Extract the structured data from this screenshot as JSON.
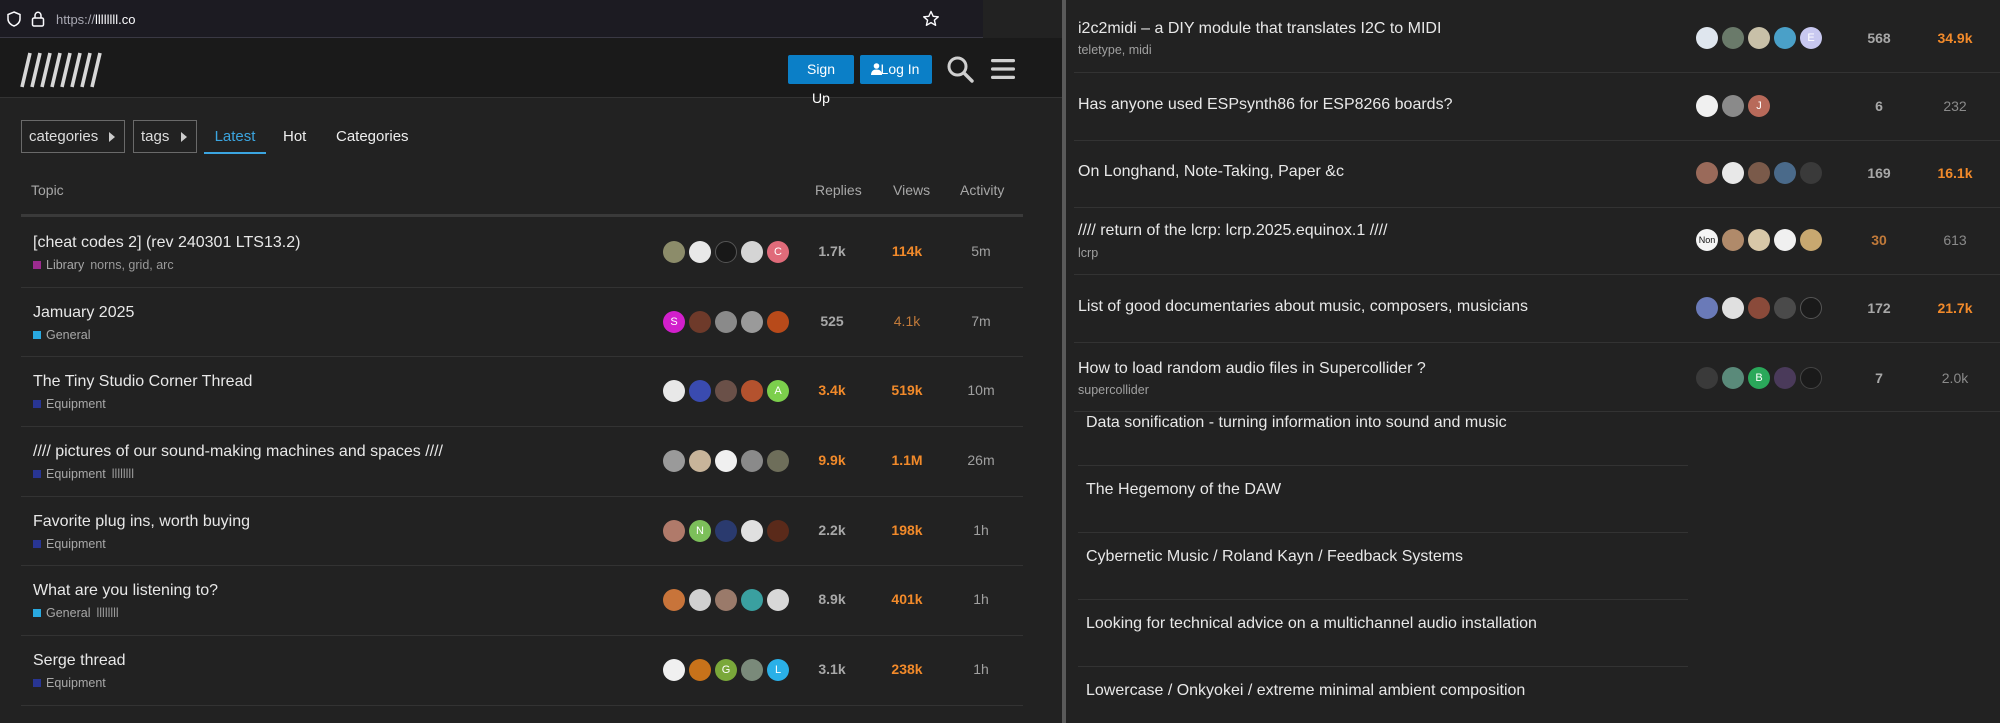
{
  "browser": {
    "url_scheme": "https://",
    "url_host": "llllllll.co"
  },
  "header": {
    "signup_label": "Sign Up",
    "login_label": "Log In"
  },
  "nav": {
    "categories_label": "categories",
    "tags_label": "tags",
    "latest_label": "Latest",
    "hot_label": "Hot",
    "categories_link_label": "Categories"
  },
  "table": {
    "col_topic": "Topic",
    "col_replies": "Replies",
    "col_views": "Views",
    "col_activity": "Activity"
  },
  "colors": {
    "library": "#9c2b8f",
    "general": "#29a9e0",
    "equipment": "#283593",
    "hot": "#f28a2a",
    "accent": "#0b7fc7"
  },
  "left_topics": [
    {
      "title": "[cheat codes 2] (rev 240301 LTS13.2)",
      "category": "Library",
      "tags": "norns, grid, arc",
      "replies": "1.7k",
      "views": "114k",
      "activity": "5m"
    },
    {
      "title": "Jamuary 2025",
      "category": "General",
      "tags": "",
      "replies": "525",
      "views": "4.1k",
      "activity": "7m"
    },
    {
      "title": "The Tiny Studio Corner Thread",
      "category": "Equipment",
      "tags": "",
      "replies": "3.4k",
      "views": "519k",
      "activity": "10m"
    },
    {
      "title": "//// pictures of our sound-making machines and spaces ////",
      "category": "Equipment",
      "tags": "llllllll",
      "replies": "9.9k",
      "views": "1.1M",
      "activity": "26m"
    },
    {
      "title": "Favorite plug ins, worth buying",
      "category": "Equipment",
      "tags": "",
      "replies": "2.2k",
      "views": "198k",
      "activity": "1h"
    },
    {
      "title": "What are you listening to?",
      "category": "General",
      "tags": "llllllll",
      "replies": "8.9k",
      "views": "401k",
      "activity": "1h"
    },
    {
      "title": "Serge thread",
      "category": "Equipment",
      "tags": "",
      "replies": "3.1k",
      "views": "238k",
      "activity": "1h"
    }
  ],
  "avatar_letters": {
    "row0": "C",
    "row1_first": "S",
    "row2_last": "A",
    "row4_second": "N",
    "row6_third": "G",
    "row6_last": "L",
    "r0_last": "E",
    "r1_last": "J",
    "r3_first": "Non",
    "r5_third": "B"
  },
  "right_topics": [
    {
      "title": "i2c2midi – a DIY module that translates I2C to MIDI",
      "tags": "teletype, midi",
      "replies": "568",
      "views": "34.9k"
    },
    {
      "title": "Has anyone used ESPsynth86 for ESP8266 boards?",
      "tags": "",
      "replies": "6",
      "views": "232"
    },
    {
      "title": "On Longhand, Note-Taking, Paper &c",
      "tags": "",
      "replies": "169",
      "views": "16.1k"
    },
    {
      "title": "//// return of the lcrp: lcrp.2025.equinox.1 ////",
      "tags": "lcrp",
      "replies": "30",
      "views": "613"
    },
    {
      "title": "List of good documentaries about music, composers, musicians",
      "tags": "",
      "replies": "172",
      "views": "21.7k"
    },
    {
      "title": "How to load random audio files in Supercollider ?",
      "tags": "supercollider",
      "replies": "7",
      "views": "2.0k"
    }
  ],
  "suggested_topics": [
    {
      "title": "Data sonification - turning information into sound and music"
    },
    {
      "title": "The Hegemony of the DAW"
    },
    {
      "title": "Cybernetic Music / Roland Kayn / Feedback Systems"
    },
    {
      "title": "Looking for technical advice on a multichannel audio installation"
    },
    {
      "title": "Lowercase / Onkyokei / extreme minimal ambient composition"
    }
  ]
}
